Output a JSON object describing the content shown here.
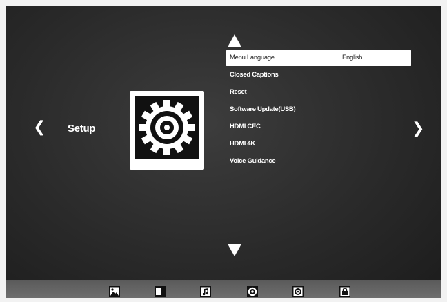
{
  "section": {
    "title": "Setup",
    "icon": "gear-icon"
  },
  "nav": {
    "left_glyph": "❮",
    "right_glyph": "❯"
  },
  "menu": {
    "items": [
      {
        "label": "Menu Language",
        "value": "English",
        "selected": true
      },
      {
        "label": "Closed Captions",
        "value": ""
      },
      {
        "label": "Reset",
        "value": ""
      },
      {
        "label": "Software Update(USB)",
        "value": ""
      },
      {
        "label": "HDMI CEC",
        "value": ""
      },
      {
        "label": "HDMI 4K",
        "value": ""
      },
      {
        "label": "Voice Guidance",
        "value": ""
      }
    ]
  },
  "bottom_bar": {
    "icons": [
      "picture-icon",
      "screen-icon",
      "music-icon",
      "channel-icon",
      "setup-icon",
      "lock-icon"
    ]
  },
  "colors": {
    "background": "#2a2a2a",
    "highlight": "#ffffff",
    "bar": "#666666"
  }
}
